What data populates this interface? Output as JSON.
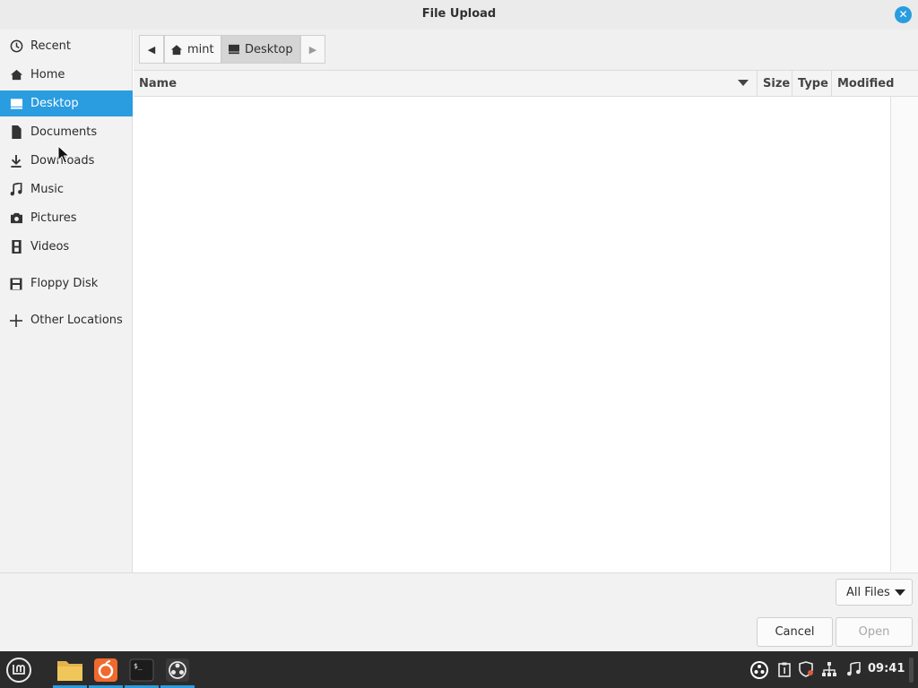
{
  "window": {
    "title": "File Upload"
  },
  "sidebar": {
    "items": [
      {
        "label": "Recent",
        "icon": "clock-icon"
      },
      {
        "label": "Home",
        "icon": "home-icon"
      },
      {
        "label": "Desktop",
        "icon": "desktop-icon",
        "active": true
      },
      {
        "label": "Documents",
        "icon": "document-icon"
      },
      {
        "label": "Downloads",
        "icon": "download-icon"
      },
      {
        "label": "Music",
        "icon": "music-icon"
      },
      {
        "label": "Pictures",
        "icon": "camera-icon"
      },
      {
        "label": "Videos",
        "icon": "film-icon"
      },
      {
        "label": "Floppy Disk",
        "icon": "floppy-icon"
      },
      {
        "label": "Other Locations",
        "icon": "plus-icon"
      }
    ]
  },
  "pathbar": {
    "segments": [
      {
        "label": "mint",
        "icon": "home-icon"
      },
      {
        "label": "Desktop",
        "icon": "desktop-icon",
        "current": true
      }
    ]
  },
  "columns": {
    "name": "Name",
    "size": "Size",
    "type": "Type",
    "modified": "Modified"
  },
  "filter": {
    "selected": "All Files"
  },
  "buttons": {
    "cancel": "Cancel",
    "open": "Open"
  },
  "taskbar": {
    "clock": "09:41",
    "apps": [
      "menu-icon",
      "files-icon",
      "firefox-icon",
      "terminal-icon",
      "obs-icon"
    ],
    "tray": [
      "obs-tray-icon",
      "clipboard-icon",
      "shield-icon",
      "network-icon",
      "sound-icon"
    ]
  },
  "colors": {
    "accent": "#2a9ce0",
    "taskbar": "#2b2b2b"
  }
}
